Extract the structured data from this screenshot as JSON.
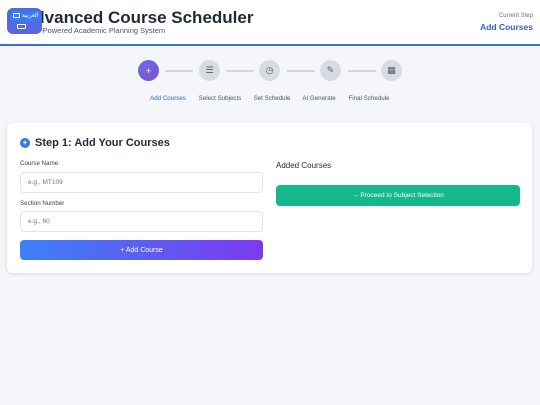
{
  "header": {
    "title": "Advanced Course Scheduler",
    "subtitle": "AI-Powered Academic Planning System",
    "language_label": "العربية",
    "current_step_label": "Current Step",
    "current_step_value": "Add Courses"
  },
  "steps": [
    {
      "label": "Add Courses",
      "icon": "plus-icon",
      "glyph": "+",
      "active": true
    },
    {
      "label": "Select Subjects",
      "icon": "list-icon",
      "glyph": "☰",
      "active": false
    },
    {
      "label": "Set Schedule",
      "icon": "clock-icon",
      "glyph": "◷",
      "active": false
    },
    {
      "label": "AI Generate",
      "icon": "magic-wand-icon",
      "glyph": "✎",
      "active": false
    },
    {
      "label": "Final Schedule",
      "icon": "calendar-icon",
      "glyph": "▦",
      "active": false
    }
  ],
  "card": {
    "title": "Step 1: Add Your Courses",
    "course_name_label": "Course Name",
    "course_name_placeholder": "e.g., MT109",
    "section_number_label": "Section Number",
    "section_number_placeholder": "e.g., 60",
    "add_button_label": "+ Add Course",
    "added_courses_title": "Added Courses",
    "proceed_button_label": "→ Proceed to Subject Selection"
  },
  "colors": {
    "accent": "#2f63c9",
    "primary_gradient_start": "#3b82f6",
    "primary_gradient_end": "#7c3aed",
    "success": "#14b88a"
  }
}
